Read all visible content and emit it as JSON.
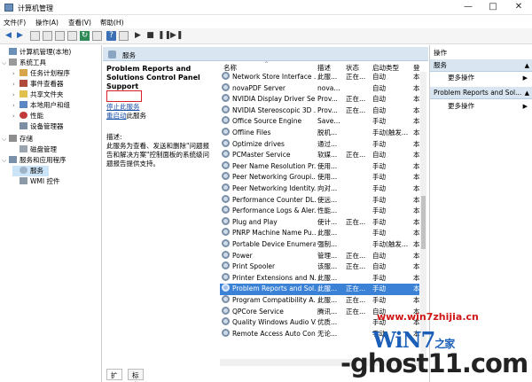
{
  "window": {
    "title": "计算机管理",
    "min": "—",
    "max": "□",
    "close": "✕"
  },
  "menu": [
    "文件(F)",
    "操作(A)",
    "查看(V)",
    "帮助(H)"
  ],
  "tree": [
    {
      "label": "计算机管理(本地)",
      "arrow": ""
    },
    {
      "label": "系统工具",
      "arrow": "⌵"
    },
    {
      "label": "任务计划程序",
      "arrow": "›"
    },
    {
      "label": "事件查看器",
      "arrow": "›"
    },
    {
      "label": "共享文件夹",
      "arrow": "›"
    },
    {
      "label": "本地用户和组",
      "arrow": "›"
    },
    {
      "label": "性能",
      "arrow": "›"
    },
    {
      "label": "设备管理器",
      "arrow": ""
    },
    {
      "label": "存储",
      "arrow": "⌵"
    },
    {
      "label": "磁盘管理",
      "arrow": ""
    },
    {
      "label": "服务和应用程序",
      "arrow": "⌵"
    },
    {
      "label": "服务",
      "arrow": ""
    },
    {
      "label": "WMI 控件",
      "arrow": ""
    }
  ],
  "center": {
    "header": "服务",
    "detail_title": "Problem Reports and Solutions Control Panel Support",
    "stop_link": "停止此服务",
    "restart_link": "重启动",
    "restart_suffix": "此服务",
    "desc_label": "描述:",
    "desc_text": "此服务为查看、发送和删除\"问题报告和解决方案\"控制面板的系统级问题报告提供支持。"
  },
  "columns": {
    "name": "名称",
    "desc": "描述",
    "status": "状态",
    "startup": "启动类型",
    "logon": "登"
  },
  "services": [
    {
      "name": "Network Store Interface ...",
      "desc": "此服...",
      "status": "正在...",
      "startup": "自动",
      "logon": "本"
    },
    {
      "name": "novaPDF Server",
      "desc": "nova...",
      "status": "",
      "startup": "自动",
      "logon": "本"
    },
    {
      "name": "NVIDIA Display Driver Se...",
      "desc": "Prov...",
      "status": "正在...",
      "startup": "自动",
      "logon": "本"
    },
    {
      "name": "NVIDIA Stereoscopic 3D ...",
      "desc": "Prov...",
      "status": "正在...",
      "startup": "自动",
      "logon": "本"
    },
    {
      "name": "Office  Source Engine",
      "desc": "Save...",
      "status": "",
      "startup": "手动",
      "logon": "本"
    },
    {
      "name": "Offline Files",
      "desc": "脱机...",
      "status": "",
      "startup": "手动(触发...",
      "logon": "本"
    },
    {
      "name": "Optimize drives",
      "desc": "通过...",
      "status": "",
      "startup": "手动",
      "logon": "本"
    },
    {
      "name": "PCMaster Service",
      "desc": "软媒...",
      "status": "正在...",
      "startup": "自动",
      "logon": "本"
    },
    {
      "name": "Peer Name Resolution Pr...",
      "desc": "使用...",
      "status": "",
      "startup": "手动",
      "logon": "本"
    },
    {
      "name": "Peer Networking Groupi...",
      "desc": "使用...",
      "status": "",
      "startup": "手动",
      "logon": "本"
    },
    {
      "name": "Peer Networking Identity...",
      "desc": "向对...",
      "status": "",
      "startup": "手动",
      "logon": "本"
    },
    {
      "name": "Performance Counter DL...",
      "desc": "使远...",
      "status": "",
      "startup": "手动",
      "logon": "本"
    },
    {
      "name": "Performance Logs & Aler...",
      "desc": "性能...",
      "status": "",
      "startup": "手动",
      "logon": "本"
    },
    {
      "name": "Plug and Play",
      "desc": "使计...",
      "status": "正在...",
      "startup": "手动",
      "logon": "本"
    },
    {
      "name": "PNRP Machine Name Pu...",
      "desc": "此服...",
      "status": "",
      "startup": "手动",
      "logon": "本"
    },
    {
      "name": "Portable Device Enumera...",
      "desc": "强制...",
      "status": "",
      "startup": "手动(触发...",
      "logon": "本"
    },
    {
      "name": "Power",
      "desc": "管理...",
      "status": "正在...",
      "startup": "自动",
      "logon": "本"
    },
    {
      "name": "Print Spooler",
      "desc": "该服...",
      "status": "正在...",
      "startup": "自动",
      "logon": "本"
    },
    {
      "name": "Printer Extensions and N...",
      "desc": "此服...",
      "status": "",
      "startup": "手动",
      "logon": "本"
    },
    {
      "name": "Problem Reports and Sol...",
      "desc": "此服...",
      "status": "正在...",
      "startup": "手动",
      "logon": "本"
    },
    {
      "name": "Program Compatibility A...",
      "desc": "此服...",
      "status": "正在...",
      "startup": "手动",
      "logon": "本"
    },
    {
      "name": "QPCore Service",
      "desc": "腾讯...",
      "status": "正在...",
      "startup": "自动",
      "logon": "本"
    },
    {
      "name": "Quality Windows Audio V...",
      "desc": "优质...",
      "status": "",
      "startup": "手动",
      "logon": "本"
    },
    {
      "name": "Remote Access Auto Con...",
      "desc": "无论...",
      "status": "",
      "startup": "手动",
      "logon": "本"
    }
  ],
  "selected_index": 19,
  "tabs": [
    "扩展",
    "标准"
  ],
  "actions": {
    "header": "操作",
    "section1": "服务",
    "more1": "更多操作",
    "section2": "Problem Reports and Sol...",
    "more2": "更多操作"
  },
  "watermark": {
    "site": "www.win7zhijia.cn",
    "logo": "WiN7",
    "logo_sup": "之家",
    "ghost": "-ghost11.com"
  }
}
